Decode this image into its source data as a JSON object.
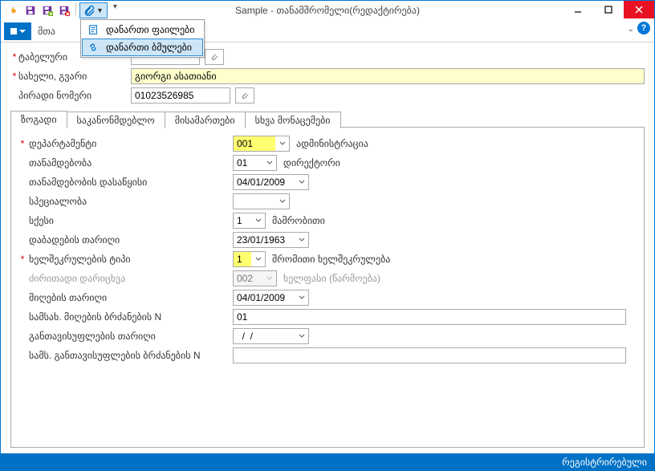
{
  "titlebar": {
    "title": "Sample - თანამშრომელი(რედაქტირება)",
    "attach_menu": {
      "files": "დანართი ფაილები",
      "links": "დანართი ბმულები"
    }
  },
  "menubar": {
    "main": "მთა"
  },
  "form": {
    "tab_number_label": "ტაბელური",
    "name_label": "სახელი, გვარი",
    "name_value": "გიორგი ასათიანი",
    "personal_id_label": "პირადი ნომერი",
    "personal_id_value": "01023526985"
  },
  "tabs": {
    "general": "ზოგადი",
    "legislation": "საკანონმდებლო",
    "addresses": "მისამართები",
    "other": "სხვა მონაცემები"
  },
  "general": {
    "department_label": "დეპარტამენტი",
    "department_code": "001",
    "department_name": "ადმინისტრაცია",
    "position_label": "თანამდებობა",
    "position_code": "01",
    "position_name": "დირექტორი",
    "position_start_label": "თანამდებობის დასაწყისი",
    "position_start_value": "04/01/2009",
    "speciality_label": "სპეციალობა",
    "sex_label": "სქესი",
    "sex_code": "1",
    "sex_name": "მამრობითი",
    "dob_label": "დაბადების თარიღი",
    "dob_value": "23/01/1963",
    "contract_type_label": "ხელშეკრულების ტიპი",
    "contract_type_code": "1",
    "contract_type_name": "შრომითი ხელშეკრულება",
    "main_charge_label": "ძირითადი დარიცხვა",
    "main_charge_code": "002",
    "main_charge_name": "ხელფასი (წარმოება)",
    "hire_date_label": "მიღების თარიღი",
    "hire_date_value": "04/01/2009",
    "hire_order_label": "სამსახ. მიღების ბრძანების N",
    "hire_order_value": "01",
    "dismiss_date_label": "განთავისუფლების თარიღი",
    "dismiss_date_value": "  /  /",
    "dismiss_order_label": "სამს. განთავისუფლების ბრძანების N",
    "dismiss_order_value": ""
  },
  "statusbar": {
    "text": "რეგისტრირებული"
  }
}
